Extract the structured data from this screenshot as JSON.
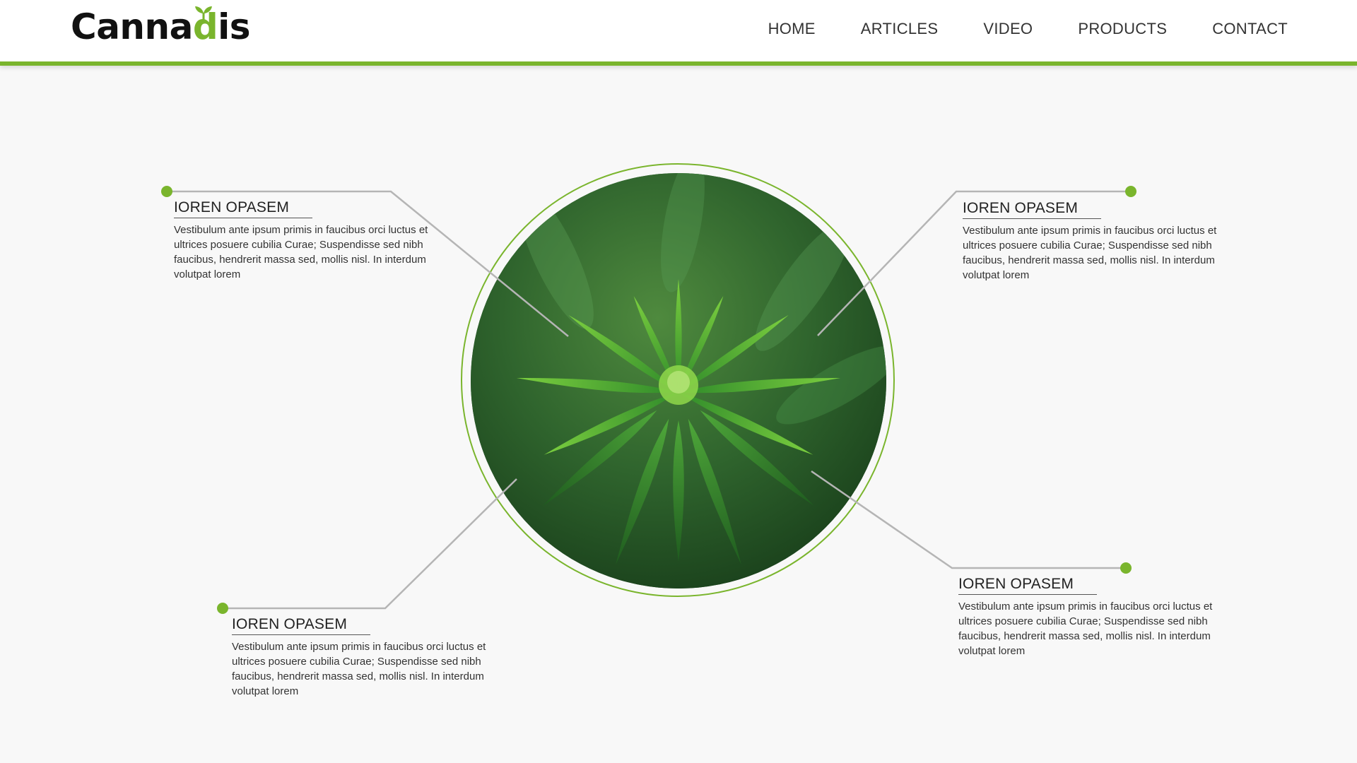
{
  "brand": {
    "name_prefix": "Canna",
    "name_accent": "d",
    "name_suffix": "is",
    "accent_color": "#7ab52d"
  },
  "nav": {
    "items": [
      "HOME",
      "ARTICLES",
      "VIDEO",
      "PRODUCTS",
      "CONTACT"
    ]
  },
  "callouts": [
    {
      "title": "IOREN OPASEM",
      "text": "Vestibulum ante ipsum primis in faucibus orci luctus et ultrices posuere cubilia Curae; Suspendisse sed nibh faucibus, hendrerit massa sed, mollis nisl. In interdum volutpat lorem"
    },
    {
      "title": "IOREN OPASEM",
      "text": "Vestibulum ante ipsum primis in faucibus orci luctus et ultrices posuere cubilia Curae; Suspendisse sed nibh faucibus, hendrerit massa sed, mollis nisl. In interdum volutpat lorem"
    },
    {
      "title": "IOREN OPASEM",
      "text": "Vestibulum ante ipsum primis in faucibus orci luctus et ultrices posuere cubilia Curae; Suspendisse sed nibh faucibus, hendrerit massa sed, mollis nisl. In interdum volutpat lorem"
    },
    {
      "title": "IOREN OPASEM",
      "text": "Vestibulum ante ipsum primis in faucibus orci luctus et ultrices posuere cubilia Curae; Suspendisse sed nibh faucibus, hendrerit massa sed, mollis nisl. In interdum volutpat lorem"
    }
  ],
  "hero": {
    "image_subject": "cannabis-plant-photo"
  },
  "colors": {
    "accent": "#7ab52d",
    "connector": "#b5b5b5",
    "background": "#f8f8f8"
  }
}
